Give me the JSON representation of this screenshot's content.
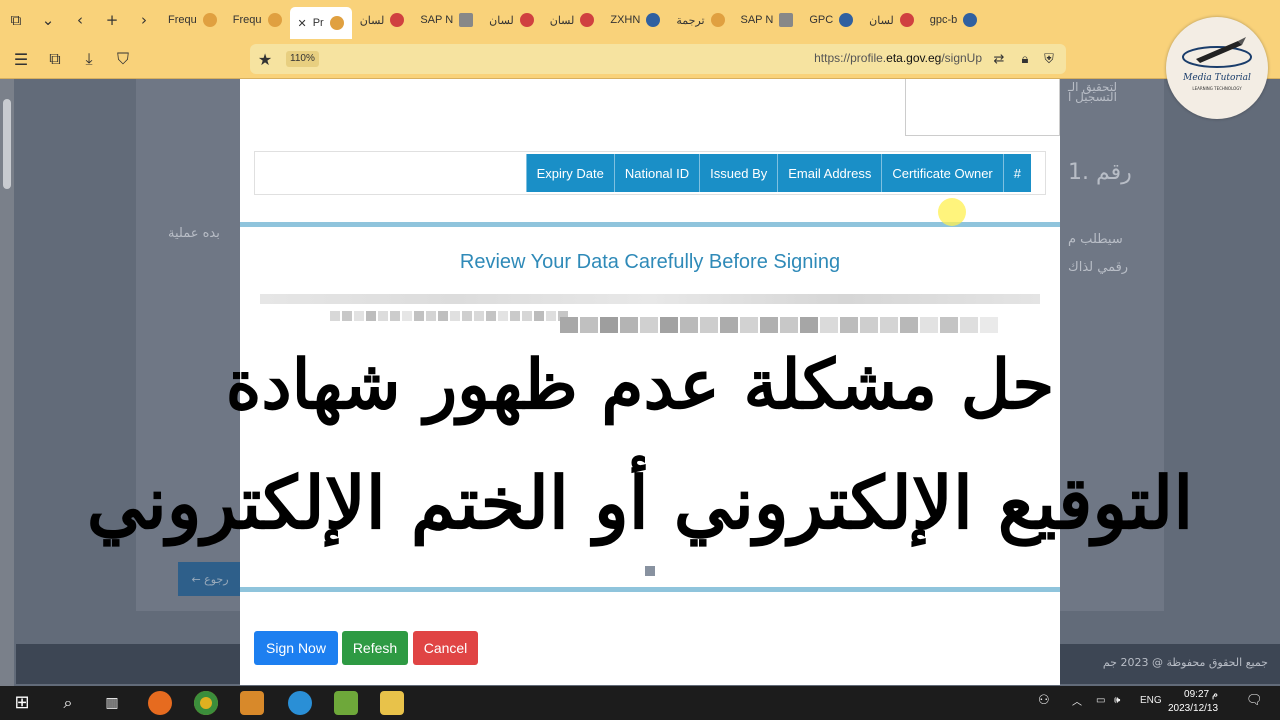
{
  "browser": {
    "tabs": [
      {
        "label": "Frequ",
        "icon": "globe-icon"
      },
      {
        "label": "Frequ",
        "icon": "globe-icon"
      },
      {
        "label": "Pr",
        "icon": "globe-icon",
        "active": true
      },
      {
        "label": "لسان",
        "icon": "red-icon"
      },
      {
        "label": "SAP N",
        "icon": "image-icon"
      },
      {
        "label": "لسان",
        "icon": "red-icon"
      },
      {
        "label": "لسان",
        "icon": "red-icon"
      },
      {
        "label": "ZXHN",
        "icon": "zte-icon"
      },
      {
        "label": "ترجمة",
        "icon": "google-icon"
      },
      {
        "label": "SAP N",
        "icon": "image-icon"
      },
      {
        "label": "GPC",
        "icon": "globe-icon"
      },
      {
        "label": "لسان",
        "icon": "red-icon"
      },
      {
        "label": "gpc-b",
        "icon": "globe-icon"
      }
    ],
    "zoom": "110%",
    "url_prefix": "https://profile.",
    "url_domain": "eta.gov.eg",
    "url_path": "/signUp"
  },
  "background_page": {
    "heading_fragment": "1. رقم",
    "text_right_1": "سيطلب م",
    "text_right_2": "رقمي لذاك",
    "text_left": "بده عملية",
    "top_right_1": "لتحقيق الـ",
    "top_right_2": "التسجيل ا",
    "back_button": "رجوع",
    "footer": "جميع الحقوق محفوظة @ 2023 جم"
  },
  "modal": {
    "table_headers": [
      "#",
      "Certificate Owner",
      "Email Address",
      "Issued By",
      "National ID",
      "Expiry Date"
    ],
    "review_title": "Review Your Data Carefully Before Signing",
    "buttons": {
      "sign": "Sign Now",
      "refresh": "Refesh",
      "cancel": "Cancel"
    }
  },
  "overlay_caption": {
    "line1": "حل مشكلة عدم ظهور شهادة",
    "line2": "التوقيع الإلكتروني أو الختم الإلكتروني"
  },
  "channel_logo": {
    "name": "Media Tutorial",
    "tagline": "LEARNING TECHNOLOGY"
  },
  "taskbar": {
    "lang": "ENG",
    "time": "09:27 م",
    "date": "2023/12/13"
  },
  "colors": {
    "accent_yellow": "#f9d27a",
    "table_header_blue": "#1a8fc7",
    "sign_btn": "#1d7ff0",
    "refresh_btn": "#2e9a43",
    "cancel_btn": "#e04444"
  }
}
